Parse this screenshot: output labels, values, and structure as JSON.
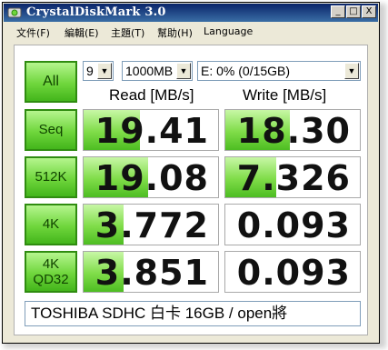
{
  "window": {
    "title": "CrystalDiskMark 3.0",
    "controls": {
      "minimize": "_",
      "maximize": "□",
      "close": "X"
    }
  },
  "menu": [
    {
      "label": "文件(F)"
    },
    {
      "label": "編輯(E)"
    },
    {
      "label": "主題(T)"
    },
    {
      "label": "幫助(H)"
    },
    {
      "label": "Language"
    }
  ],
  "controls": {
    "all_label": "All",
    "count_select": "9",
    "size_select": "1000MB",
    "drive_select": "E: 0% (0/15GB)"
  },
  "columns": {
    "read": "Read [MB/s]",
    "write": "Write [MB/s]"
  },
  "rows": [
    {
      "label": "Seq",
      "read": "19.41",
      "write": "18.30",
      "read_fill": 0.42,
      "write_fill": 0.48
    },
    {
      "label": "512K",
      "read": "19.08",
      "write": "7.326",
      "read_fill": 0.48,
      "write_fill": 0.38
    },
    {
      "label": "4K",
      "read": "3.772",
      "write": "0.093",
      "read_fill": 0.3,
      "write_fill": 0.0
    },
    {
      "label": "4K\nQD32",
      "read": "3.851",
      "write": "0.093",
      "read_fill": 0.3,
      "write_fill": 0.0
    }
  ],
  "comment": "TOSHIBA SDHC 白卡 16GB / open將",
  "colors": {
    "title_bar_start": "#0a246a",
    "title_bar_end": "#3a6ea5",
    "button_green": "#6fd63c",
    "bar_green": "#7fdc48"
  }
}
